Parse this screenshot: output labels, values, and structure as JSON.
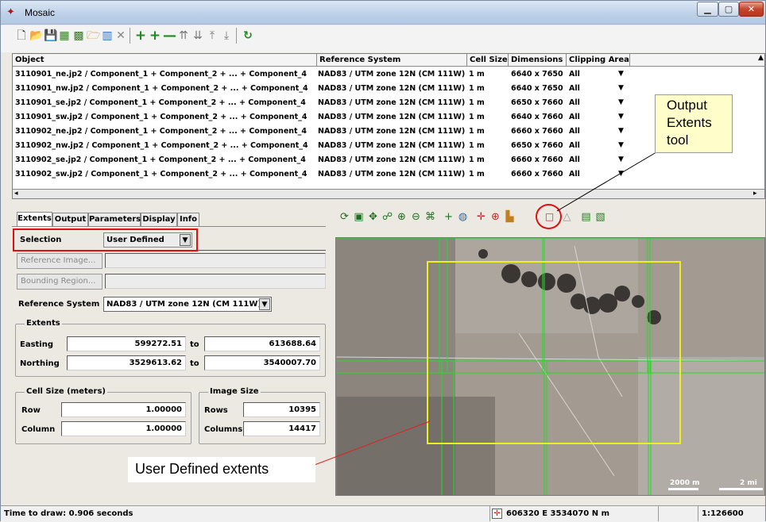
{
  "window": {
    "title": "Mosaic",
    "app_icon": "mosaic-app-icon"
  },
  "toolbar_icons": [
    "new-icon",
    "open-icon",
    "save-icon",
    "add-raster-icon",
    "add-raster-list-icon",
    "open-folder-icon",
    "chart-icon",
    "delete-icon",
    "plus-icon",
    "add-icon",
    "minus-icon",
    "move-up-icon",
    "move-down-icon",
    "move-top-icon",
    "move-bottom-icon",
    "refresh-icon"
  ],
  "table": {
    "headers": [
      "Object",
      "Reference System",
      "Cell Size",
      "Dimensions",
      "Clipping Area"
    ],
    "rows": [
      [
        "3110901_ne.jp2 / Component_1 + Component_2 + ... + Component_4",
        "NAD83 / UTM zone 12N (CM 111W)",
        "1 m",
        "6640 x 7650",
        "All"
      ],
      [
        "3110901_nw.jp2 / Component_1 + Component_2 + ... + Component_4",
        "NAD83 / UTM zone 12N (CM 111W)",
        "1 m",
        "6640 x 7650",
        "All"
      ],
      [
        "3110901_se.jp2 / Component_1 + Component_2 + ... + Component_4",
        "NAD83 / UTM zone 12N (CM 111W)",
        "1 m",
        "6650 x 7660",
        "All"
      ],
      [
        "3110901_sw.jp2 / Component_1 + Component_2 + ... + Component_4",
        "NAD83 / UTM zone 12N (CM 111W)",
        "1 m",
        "6640 x 7660",
        "All"
      ],
      [
        "3110902_ne.jp2 / Component_1 + Component_2 + ... + Component_4",
        "NAD83 / UTM zone 12N (CM 111W)",
        "1 m",
        "6660 x 7660",
        "All"
      ],
      [
        "3110902_nw.jp2 / Component_1 + Component_2 + ... + Component_4",
        "NAD83 / UTM zone 12N (CM 111W)",
        "1 m",
        "6650 x 7660",
        "All"
      ],
      [
        "3110902_se.jp2 / Component_1 + Component_2 + ... + Component_4",
        "NAD83 / UTM zone 12N (CM 111W)",
        "1 m",
        "6660 x 7660",
        "All"
      ],
      [
        "3110902_sw.jp2 / Component_1 + Component_2 + ... + Component_4",
        "NAD83 / UTM zone 12N (CM 111W)",
        "1 m",
        "6660 x 7660",
        "All"
      ]
    ]
  },
  "tabs": [
    "Extents",
    "Output",
    "Parameters",
    "Display",
    "Info"
  ],
  "extents": {
    "selection_label": "Selection",
    "selection_value": "User Defined",
    "reference_image_button": "Reference Image...",
    "bounding_region_button": "Bounding Region...",
    "reference_system_label": "Reference System",
    "reference_system_value": "NAD83 / UTM zone 12N (CM 111W)",
    "extents_group": "Extents",
    "easting_label": "Easting",
    "easting_from": "599272.51",
    "easting_to": "613688.64",
    "northing_label": "Northing",
    "northing_from": "3529613.62",
    "northing_to": "3540007.70",
    "to_label": "to",
    "cell_size_group": "Cell Size (meters)",
    "row_label": "Row",
    "row_value": "1.00000",
    "column_label": "Column",
    "column_value": "1.00000",
    "image_size_group": "Image Size",
    "rows_label": "Rows",
    "rows_value": "10395",
    "columns_label": "Columns",
    "columns_value": "14417"
  },
  "map_toolbar_icons": [
    "redraw-icon",
    "full-view-icon",
    "pan-icon",
    "group-icon",
    "zoom-in-icon",
    "zoom-out-icon",
    "zoom-box-icon",
    "add-layer-icon",
    "globe-icon",
    "gps-icon",
    "zoom-to-icon",
    "ruler-icon",
    "output-extents-icon",
    "polygon-icon",
    "spreadsheet-icon",
    "print-icon"
  ],
  "map": {
    "scale_bar_1": "2000 m",
    "scale_bar_2": "2 mi"
  },
  "status": {
    "draw_time": "Time to draw: 0.906 seconds",
    "coordinates": "606320 E 3534070 N m",
    "scale": "1:126600"
  },
  "callouts": {
    "output_extents_tool": [
      "Output",
      "Extents",
      "tool"
    ],
    "user_defined_extents": "User Defined extents"
  },
  "colors": {
    "highlight_red": "#e01010",
    "tile_outline": "#22dd22",
    "user_extent": "#eeee22",
    "callout_bg": "#fffecb"
  }
}
